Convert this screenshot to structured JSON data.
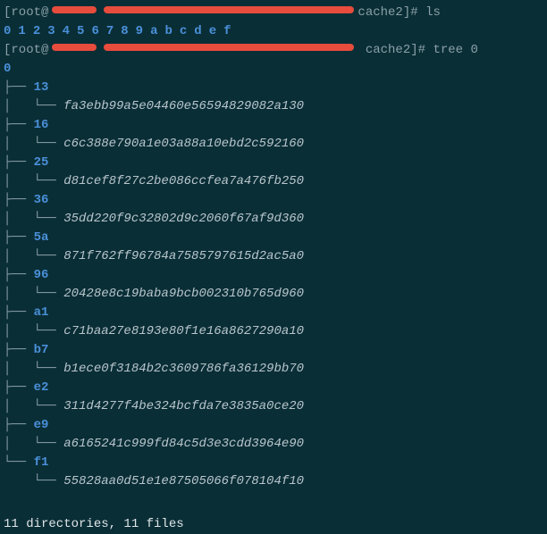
{
  "prompt1": {
    "user": "root@",
    "path_suffix": "cache2",
    "command": "ls"
  },
  "ls_output": [
    "0",
    "1",
    "2",
    "3",
    "4",
    "5",
    "6",
    "7",
    "8",
    "9",
    "a",
    "b",
    "c",
    "d",
    "e",
    "f"
  ],
  "prompt2": {
    "user": "root@",
    "path_suffix": "cache2",
    "command": "tree 0"
  },
  "tree_root": "0",
  "tree": [
    {
      "dir": "13",
      "file": "fa3ebb99a5e04460e56594829082a130"
    },
    {
      "dir": "16",
      "file": "c6c388e790a1e03a88a10ebd2c592160"
    },
    {
      "dir": "25",
      "file": "d81cef8f27c2be086ccfea7a476fb250"
    },
    {
      "dir": "36",
      "file": "35dd220f9c32802d9c2060f67af9d360"
    },
    {
      "dir": "5a",
      "file": "871f762ff96784a7585797615d2ac5a0"
    },
    {
      "dir": "96",
      "file": "20428e8c19baba9bcb002310b765d960"
    },
    {
      "dir": "a1",
      "file": "c71baa27e8193e80f1e16a8627290a10"
    },
    {
      "dir": "b7",
      "file": "b1ece0f3184b2c3609786fa36129bb70"
    },
    {
      "dir": "e2",
      "file": "311d4277f4be324bcfda7e3835a0ce20"
    },
    {
      "dir": "e9",
      "file": "a6165241c999fd84c5d3e3cdd3964e90"
    },
    {
      "dir": "f1",
      "file": "55828aa0d51e1e87505066f078104f10"
    }
  ],
  "summary": "11 directories, 11 files"
}
